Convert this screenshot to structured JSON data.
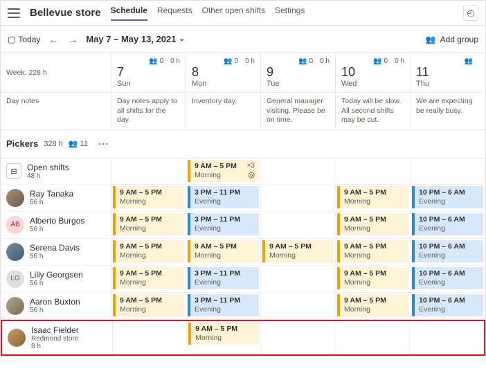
{
  "header": {
    "title": "Bellevue store",
    "tabs": [
      "Schedule",
      "Requests",
      "Other open shifts",
      "Settings"
    ],
    "active_tab": 0
  },
  "toolbar": {
    "today": "Today",
    "range": "May 7 – May 13, 2021",
    "add_group": "Add group"
  },
  "week_total": "Week: 228 h",
  "days": [
    {
      "num": "7",
      "lbl": "Sun",
      "g": "0",
      "h": "0 h",
      "note": "Day notes apply to all shifts for the day."
    },
    {
      "num": "8",
      "lbl": "Mon",
      "g": "0",
      "h": "0 h",
      "note": "Inventory day."
    },
    {
      "num": "9",
      "lbl": "Tue",
      "g": "0",
      "h": "0 h",
      "note": "General manager visiting. Please be on time."
    },
    {
      "num": "10",
      "lbl": "Wed",
      "g": "0",
      "h": "0 h",
      "note": "Today will be slow. All second shifts may be cut."
    },
    {
      "num": "11",
      "lbl": "Thu",
      "g": "",
      "h": "",
      "note": "We are expecting be really busy."
    }
  ],
  "day_notes_label": "Day notes",
  "group": {
    "name": "Pickers",
    "hours": "328 h",
    "count": "11"
  },
  "open_shifts": {
    "label": "Open shifts",
    "hours": "48 h"
  },
  "open_row": [
    null,
    {
      "t": "9 AM – 5 PM",
      "s": "Morning",
      "k": "m",
      "mult": "×3",
      "loc": "◎"
    },
    null,
    null,
    null
  ],
  "people": [
    {
      "name": "Ray Tanaka",
      "hrs": "56 h",
      "av": "av-img",
      "init": "",
      "cells": [
        {
          "t": "9 AM – 5 PM",
          "s": "Morning",
          "k": "m"
        },
        {
          "t": "3 PM – 11 PM",
          "s": "Evening",
          "k": "e"
        },
        null,
        {
          "t": "9 AM – 5 PM",
          "s": "Morning",
          "k": "m"
        },
        {
          "t": "10 PM – 6 AM",
          "s": "Evening",
          "k": "e"
        }
      ]
    },
    {
      "name": "Alberto Burgos",
      "hrs": "56 h",
      "av": "av-ab",
      "init": "AB",
      "cells": [
        {
          "t": "9 AM – 5 PM",
          "s": "Morning",
          "k": "m"
        },
        {
          "t": "3 PM – 11 PM",
          "s": "Evening",
          "k": "e"
        },
        null,
        {
          "t": "9 AM – 5 PM",
          "s": "Morning",
          "k": "m"
        },
        {
          "t": "10 PM – 6 AM",
          "s": "Evening",
          "k": "e"
        }
      ]
    },
    {
      "name": "Serena Davis",
      "hrs": "56 h",
      "av": "av-sd",
      "init": "",
      "cells": [
        {
          "t": "9 AM – 5 PM",
          "s": "Morning",
          "k": "m"
        },
        {
          "t": "9 AM – 5 PM",
          "s": "Morning",
          "k": "m"
        },
        {
          "t": "9 AM – 5 PM",
          "s": "Morning",
          "k": "m"
        },
        {
          "t": "9 AM – 5 PM",
          "s": "Morning",
          "k": "m"
        },
        {
          "t": "10 PM – 6 AM",
          "s": "Evening",
          "k": "e"
        }
      ]
    },
    {
      "name": "Lilly Georgsen",
      "hrs": "56 h",
      "av": "av-lg",
      "init": "LG",
      "cells": [
        {
          "t": "9 AM – 5 PM",
          "s": "Morning",
          "k": "m"
        },
        {
          "t": "3 PM – 11 PM",
          "s": "Evening",
          "k": "e"
        },
        null,
        {
          "t": "9 AM – 5 PM",
          "s": "Morning",
          "k": "m"
        },
        {
          "t": "10 PM – 6 AM",
          "s": "Evening",
          "k": "e"
        }
      ]
    },
    {
      "name": "Aaron Buxton",
      "hrs": "56 h",
      "av": "av-abx",
      "init": "",
      "cells": [
        {
          "t": "9 AM – 5 PM",
          "s": "Morning",
          "k": "m"
        },
        {
          "t": "3 PM – 11 PM",
          "s": "Evening",
          "k": "e"
        },
        null,
        {
          "t": "9 AM – 5 PM",
          "s": "Morning",
          "k": "m"
        },
        {
          "t": "10 PM – 6 AM",
          "s": "Evening",
          "k": "e"
        }
      ]
    }
  ],
  "hl_person": {
    "name": "Isaac Fielder",
    "sub": "Redmond store",
    "hrs": "8 h",
    "av": "av-if",
    "cells": [
      null,
      {
        "t": "9 AM – 5 PM",
        "s": "Morning",
        "k": "m"
      },
      null,
      null,
      null
    ]
  }
}
